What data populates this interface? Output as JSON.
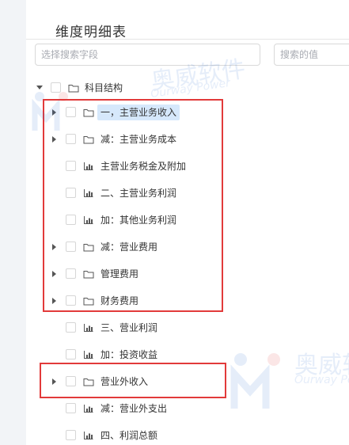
{
  "panel": {
    "title": "维度明细表",
    "search_field": {
      "placeholder": "选择搜索字段",
      "value": ""
    },
    "search_value": {
      "placeholder": "搜索的值",
      "value": ""
    }
  },
  "tree": {
    "root": {
      "label": "科目结构",
      "expanded": true
    },
    "items": [
      {
        "label": "一，主营业务收入",
        "type": "folder",
        "expandable": true,
        "selected": true
      },
      {
        "label": "减：主营业务成本",
        "type": "folder",
        "expandable": true,
        "selected": false
      },
      {
        "label": "主营业务税金及附加",
        "type": "chart",
        "expandable": false,
        "selected": false
      },
      {
        "label": "二、主营业务利润",
        "type": "chart",
        "expandable": false,
        "selected": false
      },
      {
        "label": "加：其他业务利润",
        "type": "chart",
        "expandable": false,
        "selected": false
      },
      {
        "label": "减：营业费用",
        "type": "folder",
        "expandable": true,
        "selected": false
      },
      {
        "label": "管理费用",
        "type": "folder",
        "expandable": true,
        "selected": false
      },
      {
        "label": "财务费用",
        "type": "folder",
        "expandable": true,
        "selected": false
      },
      {
        "label": "三、营业利润",
        "type": "chart",
        "expandable": false,
        "selected": false
      },
      {
        "label": "加：投资收益",
        "type": "chart",
        "expandable": false,
        "selected": false
      },
      {
        "label": "营业外收入",
        "type": "folder",
        "expandable": true,
        "selected": false
      },
      {
        "label": "减：营业外支出",
        "type": "chart",
        "expandable": false,
        "selected": false
      },
      {
        "label": "四、利润总额",
        "type": "chart",
        "expandable": false,
        "selected": false
      }
    ]
  },
  "watermark": {
    "brand": "奥威软件",
    "tagline": "Ourway Power"
  },
  "colors": {
    "highlight_box": "#e23a3a",
    "selected_bg": "#d6e8fb",
    "watermark": "#2f6fd6"
  }
}
